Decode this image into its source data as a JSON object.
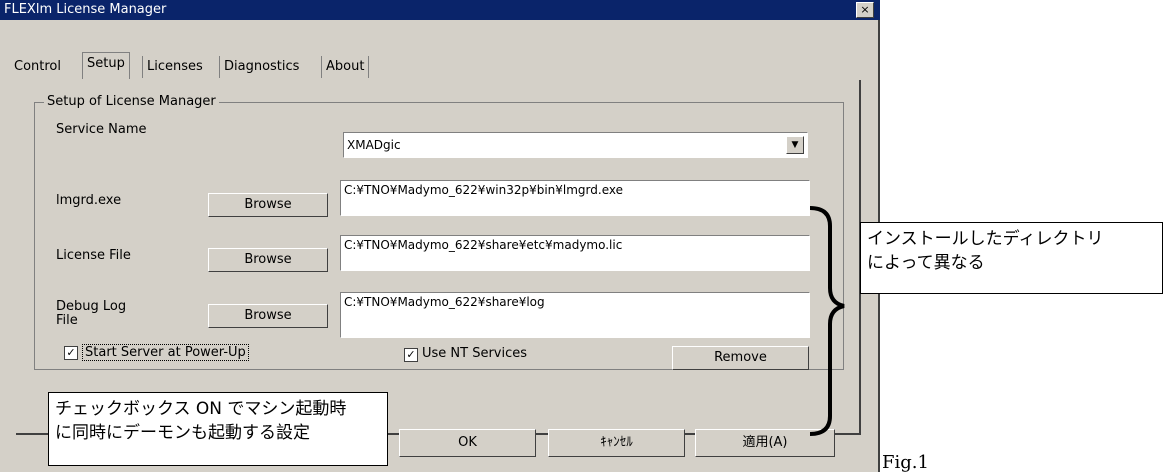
{
  "window": {
    "title": "FLEXlm License Manager",
    "close_label": "×"
  },
  "tabs": [
    "Control",
    "Setup",
    "Licenses",
    "Diagnostics",
    "About"
  ],
  "group_title": "Setup of License Manager",
  "service": {
    "label": "Service Name",
    "value": "XMADgic",
    "arrow": "▼"
  },
  "rows": [
    {
      "label": "lmgrd.exe",
      "button": "Browse",
      "value": "C:¥TNO¥Madymo_622¥win32p¥bin¥lmgrd.exe"
    },
    {
      "label": "License File",
      "button": "Browse",
      "value": "C:¥TNO¥Madymo_622¥share¥etc¥madymo.lic"
    },
    {
      "label": "Debug Log File",
      "button": "Browse",
      "value": "C:¥TNO¥Madymo_622¥share¥log"
    }
  ],
  "checks": {
    "start_server": "Start Server at Power-Up",
    "use_nt": "Use NT Services",
    "mark": "✓"
  },
  "remove_label": "Remove",
  "footer": {
    "ok": "OK",
    "cancel": "ｷｬﾝｾﾙ",
    "apply": "適用(A)"
  },
  "callouts": {
    "right": [
      "インストールしたディレクトリ",
      "によって異なる"
    ],
    "bottom": [
      "チェックボックス ON でマシン起動時",
      "に同時にデーモンも起動する設定"
    ]
  },
  "figure_label": "Fig.1"
}
